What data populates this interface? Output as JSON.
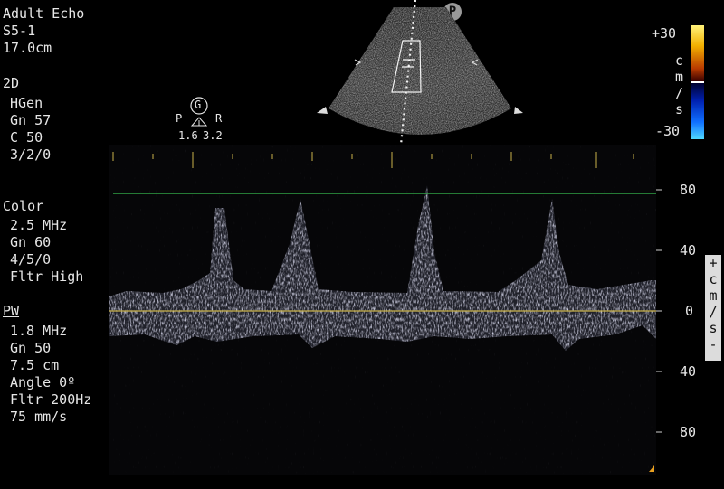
{
  "header": {
    "preset": "Adult Echo",
    "probe": "S5-1",
    "depth": "17.0cm"
  },
  "mode_2d": {
    "title": "2D",
    "lines": [
      "HGen",
      "Gn 57",
      "C 50",
      "3/2/0"
    ]
  },
  "mode_color": {
    "title": "Color",
    "lines": [
      "2.5 MHz",
      "Gn 60",
      "4/5/0",
      "Fltr High"
    ]
  },
  "mode_pw": {
    "title": "PW",
    "lines": [
      "1.8 MHz",
      "Gn 50",
      "7.5 cm",
      "Angle 0º",
      "Fltr 200Hz",
      "75 mm/s"
    ]
  },
  "probe_badge": "P",
  "g_marker": {
    "letter": "G",
    "left_label": "P",
    "right_label": "R",
    "left_value": "1.6",
    "right_value": "3.2"
  },
  "color_scale": {
    "top": "+30",
    "bottom": "-30",
    "unit_chars": [
      "c",
      "m",
      "/",
      "s"
    ]
  },
  "velocity_scale": {
    "labels": [
      "80",
      "40",
      "0",
      "40",
      "80"
    ],
    "unit_chars": [
      "+",
      "c",
      "m",
      "/",
      "s",
      "-"
    ]
  },
  "colors": {
    "baseline": "#c9b24a",
    "limit_line": "#38c050",
    "spectrum": "#c8c8e8"
  }
}
